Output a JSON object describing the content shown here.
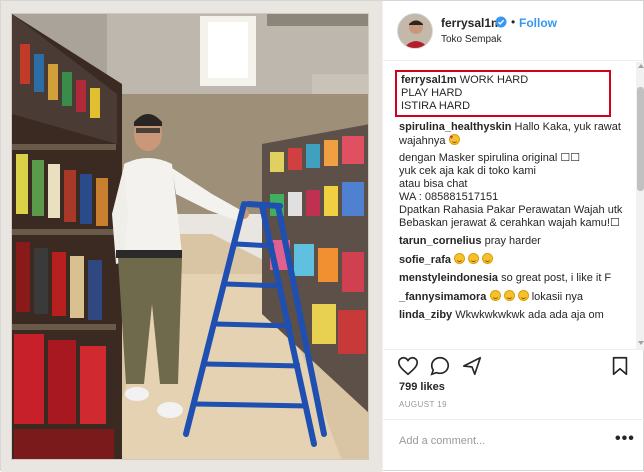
{
  "post": {
    "username": "ferrysal1m",
    "follow_label": "Follow",
    "separator": "•",
    "location": "Toko Sempak"
  },
  "caption": {
    "username": "ferrysal1m",
    "lines": [
      "WORK HARD",
      "PLAY HARD",
      "ISTIRA HARD"
    ]
  },
  "comments": [
    {
      "username": "spirulina_healthyskin",
      "text": "Hallo Kaka, yuk rawat wajahnya"
    },
    {
      "username": "",
      "text": "dengan Masker spirulina original ☐☐"
    },
    {
      "username": "",
      "text": "yuk cek aja kak di toko kami"
    },
    {
      "username": "",
      "text": "atau bisa chat"
    },
    {
      "username": "",
      "text": "WA : 085881517151"
    },
    {
      "username": "",
      "text": "Dpatkan Rahasia Pakar Perawatan Wajah utk Bebaskan jerawat & cerahkan wajah kamu!☐"
    },
    {
      "username": "tarun_cornelius",
      "text": "pray harder"
    },
    {
      "username": "sofie_rafa",
      "text": ""
    },
    {
      "username": "menstyleindonesia",
      "text": "so great post, i like it F"
    },
    {
      "username": "_fannysimamora",
      "text": "lokasii nya"
    },
    {
      "username": "linda_ziby",
      "text": "Wkwkwkwkwk ada ada aja om"
    }
  ],
  "likes": "799 likes",
  "date": "AUGUST 19",
  "add_comment_placeholder": "Add a comment...",
  "more_label": "•••",
  "colors": {
    "accent": "#3897f0",
    "highlight_box": "#d0021b",
    "text": "#262626",
    "muted": "#999999"
  },
  "icons": [
    "verified-badge-icon",
    "heart-icon",
    "comment-icon",
    "share-icon",
    "bookmark-icon",
    "more-icon"
  ]
}
